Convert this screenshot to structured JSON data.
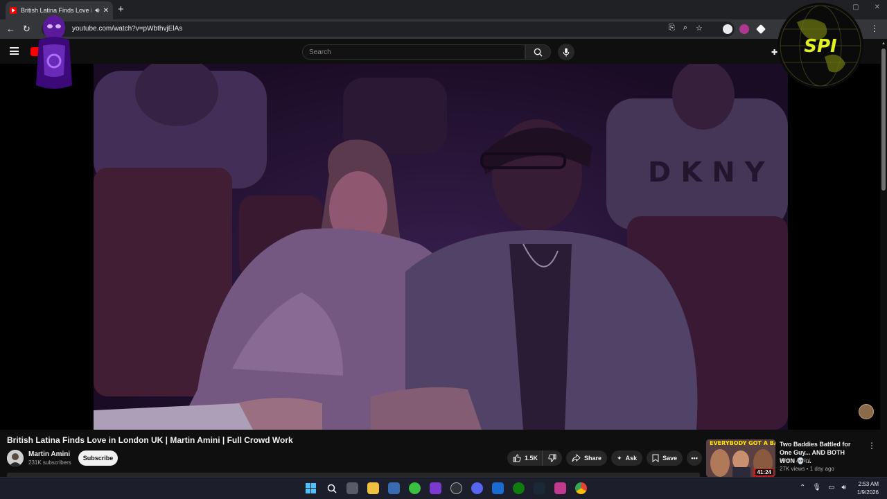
{
  "browser": {
    "tab_title": "British Latina Finds Love in London UK | Martin Amini | Full Crowd Work - YouTube",
    "url": "youtube.com/watch?v=pWbthvjElAs",
    "new_tab": "+",
    "tab_close": "✕"
  },
  "youtube": {
    "logo_text": "m",
    "search_placeholder": "Search"
  },
  "overlay": {
    "globe_text": "SPI"
  },
  "video": {
    "title": "British Latina Finds Love in London UK | Martin Amini | Full Crowd Work",
    "channel_name": "Martin Amini",
    "subscribers": "231K subscribers",
    "subscribe_label": "Subscribe",
    "likes": "1.5K",
    "share_label": "Share",
    "ask_label": "Ask",
    "save_label": "Save"
  },
  "recommendation": {
    "thumb_text": "EVERYBODY GOT A BADDIE",
    "duration": "41:24",
    "title": "Two Baddies Battled for One Guy... AND BOTH WON 💀 ...",
    "channel": "Martin Amini",
    "meta": "27K views • 1 day ago"
  },
  "taskbar": {
    "time": "2:53 AM",
    "date": "1/9/2026"
  },
  "colors": {
    "yt_red": "#ff0000",
    "background": "#0f0f0f",
    "chip": "#272727",
    "thumb_yellow": "#ffe600"
  }
}
